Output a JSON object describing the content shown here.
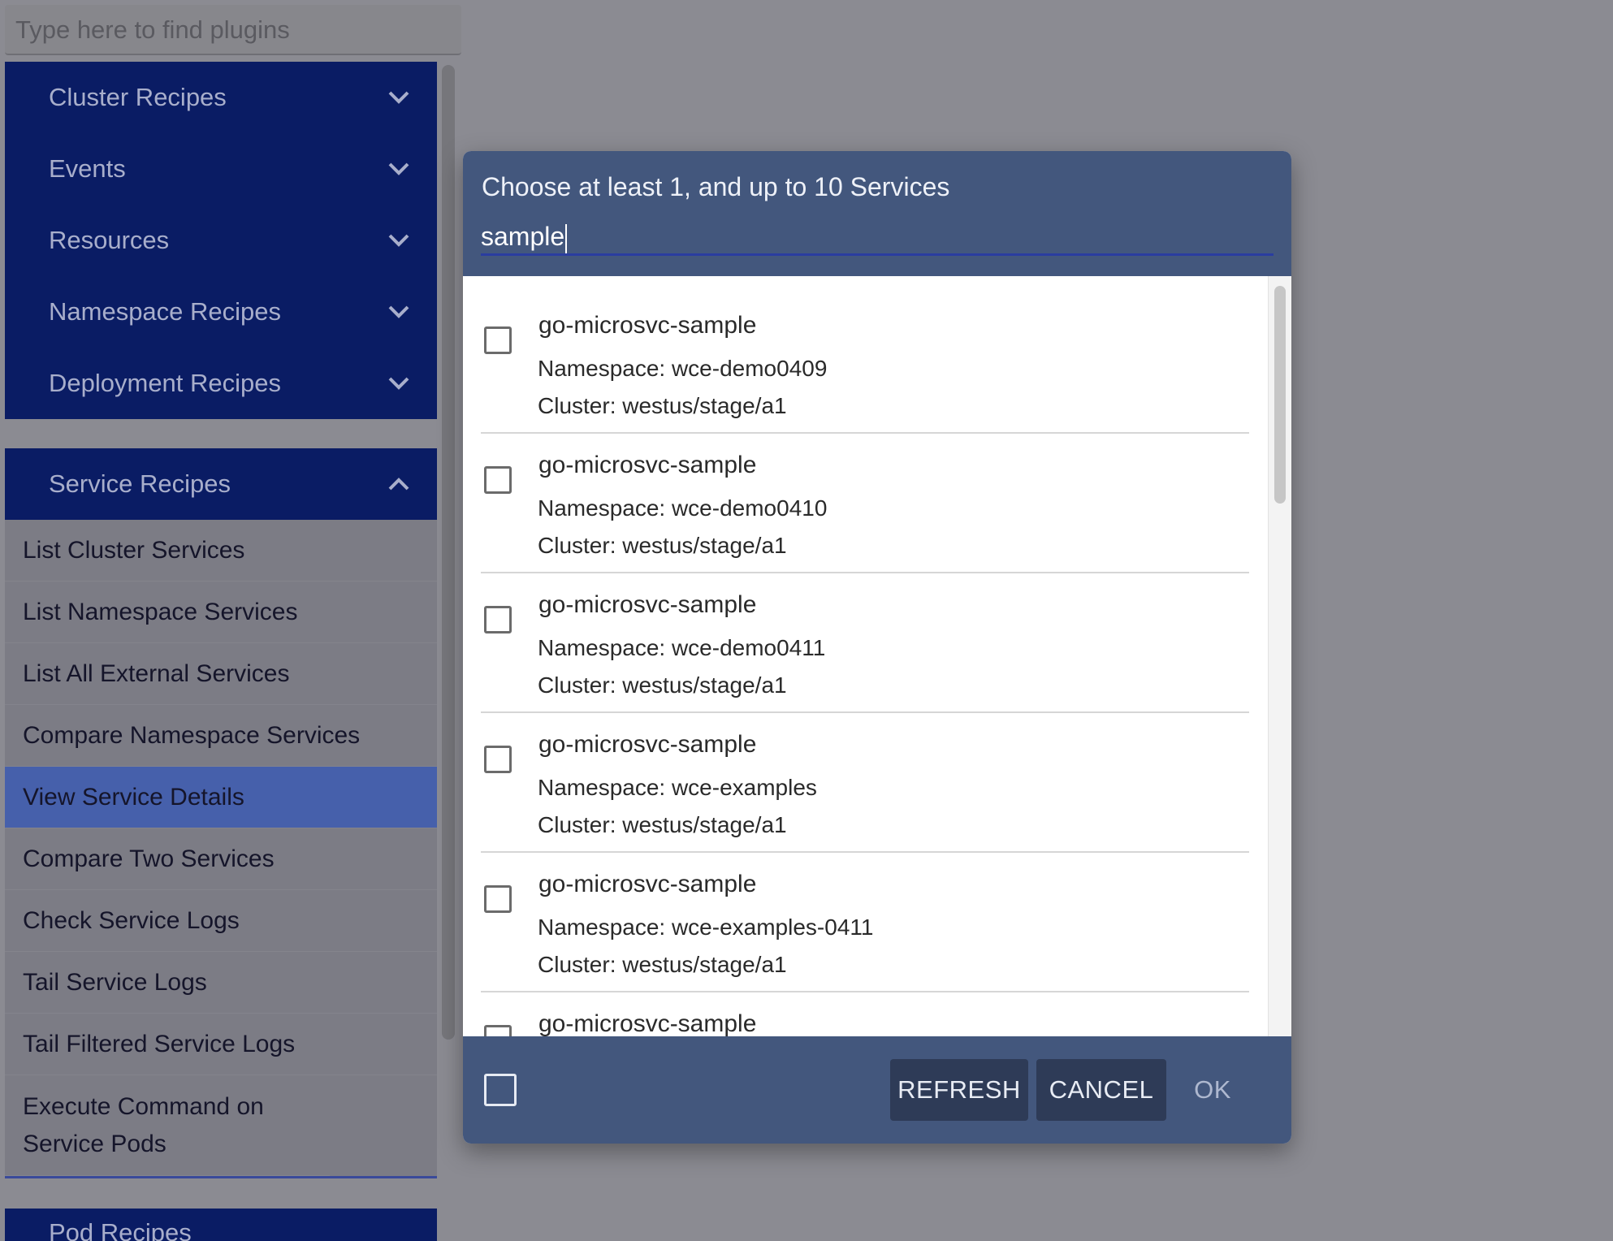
{
  "sidebar": {
    "search_placeholder": "Type here to find plugins",
    "groups": [
      {
        "label": "Cluster Recipes",
        "icon": "chevron-down-icon"
      },
      {
        "label": "Events",
        "icon": "chevron-down-icon"
      },
      {
        "label": "Resources",
        "icon": "chevron-down-icon"
      },
      {
        "label": "Namespace Recipes",
        "icon": "chevron-down-icon"
      },
      {
        "label": "Deployment Recipes",
        "icon": "chevron-down-icon"
      }
    ],
    "service_recipes": {
      "label": "Service Recipes",
      "icon": "chevron-up-icon",
      "items": [
        {
          "label": "List Cluster Services"
        },
        {
          "label": "List Namespace Services"
        },
        {
          "label": "List All External Services"
        },
        {
          "label": "Compare Namespace Services"
        },
        {
          "label": "View Service Details",
          "active": true
        },
        {
          "label": "Compare Two Services"
        },
        {
          "label": "Check Service Logs"
        },
        {
          "label": "Tail Service Logs"
        },
        {
          "label": "Tail Filtered Service Logs"
        },
        {
          "label": "Execute Command on Service Pods"
        }
      ]
    },
    "next_group_partial": "Pod Recipes"
  },
  "dialog": {
    "title": "Choose at least 1, and up to 10 Services",
    "filter_value": "sample",
    "services": [
      {
        "name": "go-microsvc-sample",
        "namespace": "Namespace: wce-demo0409",
        "cluster": "Cluster: westus/stage/a1"
      },
      {
        "name": "go-microsvc-sample",
        "namespace": "Namespace: wce-demo0410",
        "cluster": "Cluster: westus/stage/a1"
      },
      {
        "name": "go-microsvc-sample",
        "namespace": "Namespace: wce-demo0411",
        "cluster": "Cluster: westus/stage/a1"
      },
      {
        "name": "go-microsvc-sample",
        "namespace": "Namespace: wce-examples",
        "cluster": "Cluster: westus/stage/a1"
      },
      {
        "name": "go-microsvc-sample",
        "namespace": "Namespace: wce-examples-0411",
        "cluster": "Cluster: westus/stage/a1"
      },
      {
        "name": "go-microsvc-sample",
        "namespace": "",
        "cluster": ""
      }
    ],
    "buttons": {
      "refresh": "REFRESH",
      "cancel": "CANCEL",
      "ok": "OK"
    }
  },
  "colors": {
    "backdrop": "#8b8b92",
    "nav_dark": "#0a1c64",
    "active_item": "#4660ab",
    "dialog_chrome": "#43577d"
  }
}
